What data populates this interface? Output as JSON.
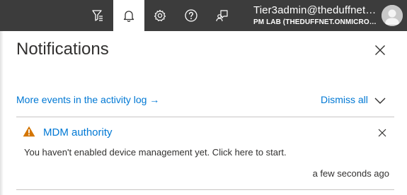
{
  "topbar": {
    "icons": {
      "portal_settings": "directory-filter-icon",
      "notifications": "bell-icon",
      "settings": "gear-icon",
      "help": "help-icon",
      "feedback": "feedback-icon"
    },
    "account": {
      "user": "Tier3admin@theduffnet…",
      "directory": "PM LAB (THEDUFFNET.ONMICRO…"
    },
    "colors": {
      "bar_background": "#3c3c3c",
      "active_button_background": "#ffffff"
    }
  },
  "panel": {
    "title": "Notifications",
    "activity_log_link": "More events in the activity log →",
    "dismiss_all": "Dismiss all"
  },
  "notifications": [
    {
      "severity": "warning",
      "title": "MDM authority",
      "message": "You haven't enabled device management yet. Click here to start.",
      "time": "a few seconds ago"
    }
  ],
  "colors": {
    "link": "#0078d4",
    "warning": "#d47500",
    "text": "#323130",
    "divider": "#c8c6c4"
  }
}
